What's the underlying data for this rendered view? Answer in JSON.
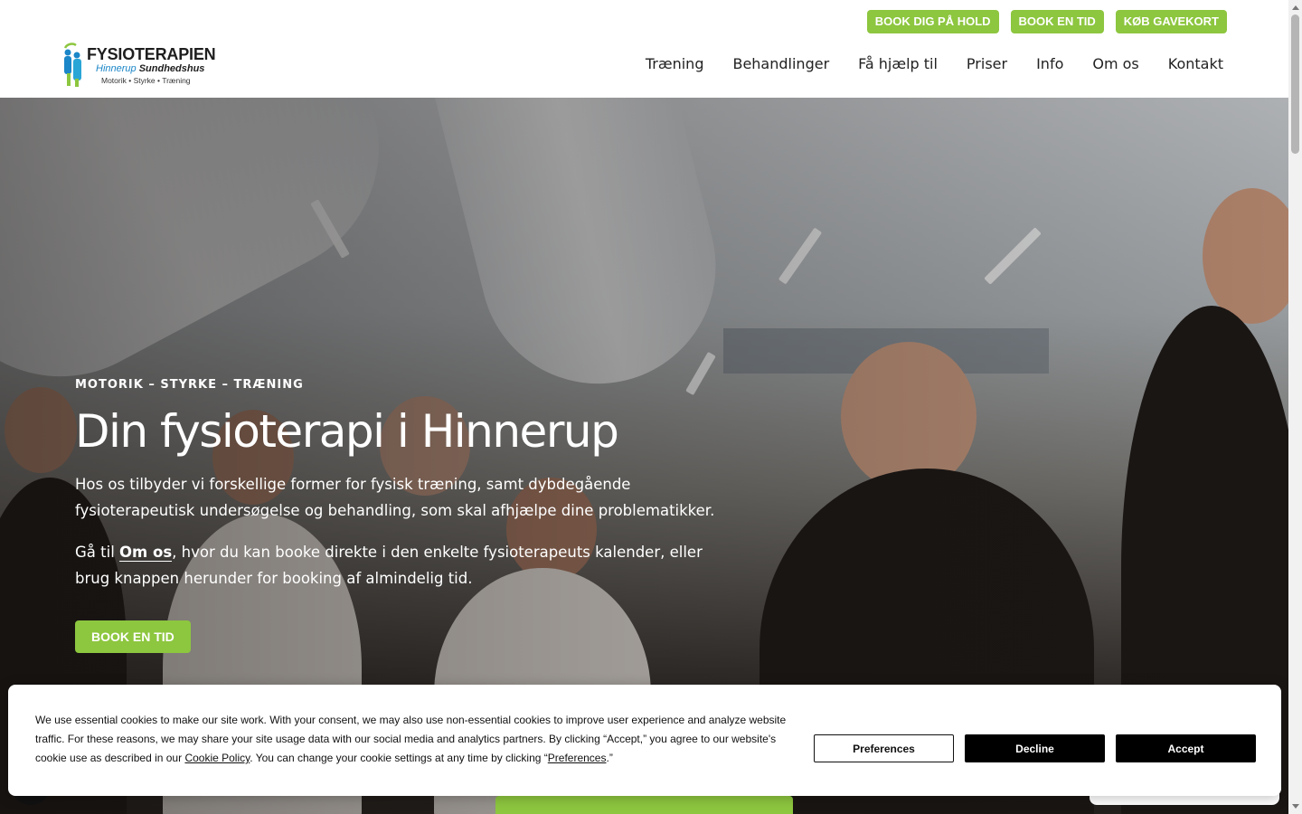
{
  "header": {
    "top_buttons": [
      "BOOK DIG PÅ HOLD",
      "BOOK EN TID",
      "KØB GAVEKORT"
    ],
    "logo": {
      "title": "FYSIOTERAPIEN",
      "sub_blue": "Hinnerup",
      "sub_bold": "Sundhedshus",
      "tagline": "Motorik • Styrke • Træning"
    },
    "nav": [
      "Træning",
      "Behandlinger",
      "Få hjælp til",
      "Priser",
      "Info",
      "Om os",
      "Kontakt"
    ]
  },
  "hero": {
    "eyebrow": "MOTORIK – STYRKE – TRÆNING",
    "title": "Din fysioterapi i Hinnerup",
    "paragraph1": "Hos os tilbyder vi forskellige former for fysisk træning, samt dybdegående fysioterapeutisk undersøgelse og behandling, som skal afhjælpe dine problematikker.",
    "p2_before": "Gå til ",
    "p2_link": "Om os",
    "p2_after": ", hvor du kan booke direkte i den enkelte fysioterapeuts kalender, eller brug knappen herunder for booking af almindelig tid.",
    "cta": "BOOK EN TID"
  },
  "cookie": {
    "text_part1": "We use essential cookies to make our site work. With your consent, we may also use non-essential cookies to improve user experience and analyze website traffic. For these reasons, we may share your site usage data with our social media and analytics partners. By clicking “Accept,” you agree to our website's cookie use as described in our ",
    "policy_link": "Cookie Policy",
    "text_part2": ". You can change your cookie settings at any time by clicking “",
    "preferences_link": "Preferences",
    "text_part3": ".”",
    "buttons": {
      "preferences": "Preferences",
      "decline": "Decline",
      "accept": "Accept"
    }
  },
  "colors": {
    "brand_green": "#8dc63f",
    "dark": "#000000",
    "logo_blue": "#1b86c8"
  }
}
